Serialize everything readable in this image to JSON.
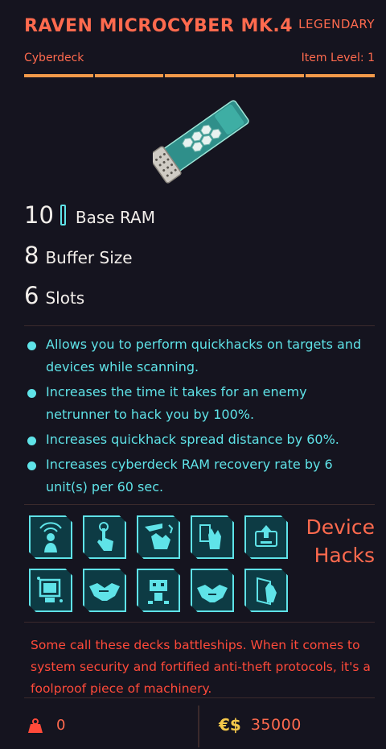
{
  "item": {
    "name": "RAVEN MICROCYBER MK.4",
    "rarity": "LEGENDARY",
    "type": "Cyberdeck",
    "item_level": "Item Level: 1",
    "item_level_bar_segments": 5
  },
  "stats": [
    {
      "value": "10",
      "label": "Base RAM",
      "icon": "ram-chip-icon"
    },
    {
      "value": "8",
      "label": "Buffer Size"
    },
    {
      "value": "6",
      "label": "Slots"
    }
  ],
  "effects": [
    "Allows you to perform quickhacks on targets and devices while scanning.",
    "Increases the time it takes for an enemy netrunner to hack you by 100%.",
    "Increases quickhack spread distance by 60%.",
    "Increases cyberdeck RAM recovery rate by 6 unit(s) per 60 sec."
  ],
  "device_hacks": {
    "label_line1": "Device",
    "label_line2": "Hacks",
    "icons": [
      "signal-person-icon",
      "touch-hand-icon",
      "hand-breach-icon",
      "hand-panel-icon",
      "upload-icon",
      "computer-icon",
      "handshake-icon",
      "robot-icon",
      "handshake-alt-icon",
      "door-hand-icon"
    ]
  },
  "flavor_text": "Some call these decks battleships. When it comes to system security and fortified anti-theft protocols, it's a foolproof piece of machinery.",
  "footer": {
    "weight_icon": "weight-icon",
    "weight": "0",
    "currency_symbol": "€$",
    "price": "35000"
  },
  "colors": {
    "accent": "#ff6a4e",
    "cyan": "#5fe3e8",
    "flavor": "#ff4a3a",
    "level_bar": "#f29a4a",
    "currency": "#f5c84a",
    "background": "#15141f"
  }
}
